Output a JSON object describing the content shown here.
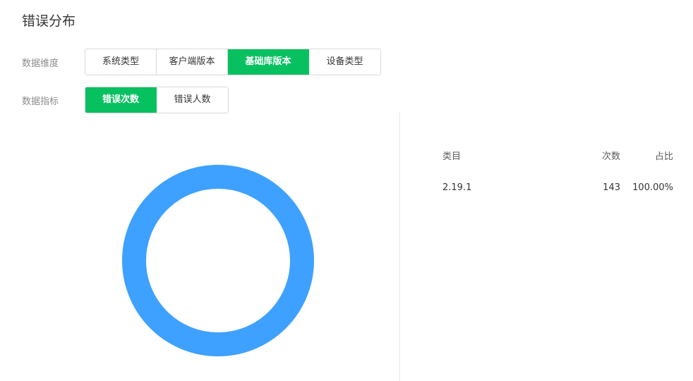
{
  "title": "错误分布",
  "dimension": {
    "label": "数据维度",
    "options": [
      "系统类型",
      "客户端版本",
      "基础库版本",
      "设备类型"
    ],
    "selected": "基础库版本"
  },
  "metric": {
    "label": "数据指标",
    "options": [
      "错误次数",
      "错误人数"
    ],
    "selected": "错误次数"
  },
  "table": {
    "headers": {
      "category": "类目",
      "count": "次数",
      "ratio": "占比"
    },
    "rows": [
      {
        "category": "2.19.1",
        "count": "143",
        "ratio": "100.00%"
      }
    ]
  },
  "colors": {
    "accent": "#07c160",
    "series": "#3ea1ff"
  },
  "chart_data": {
    "type": "pie",
    "categories": [
      "2.19.1"
    ],
    "values": [
      143
    ],
    "donut": true,
    "legend": "none"
  }
}
